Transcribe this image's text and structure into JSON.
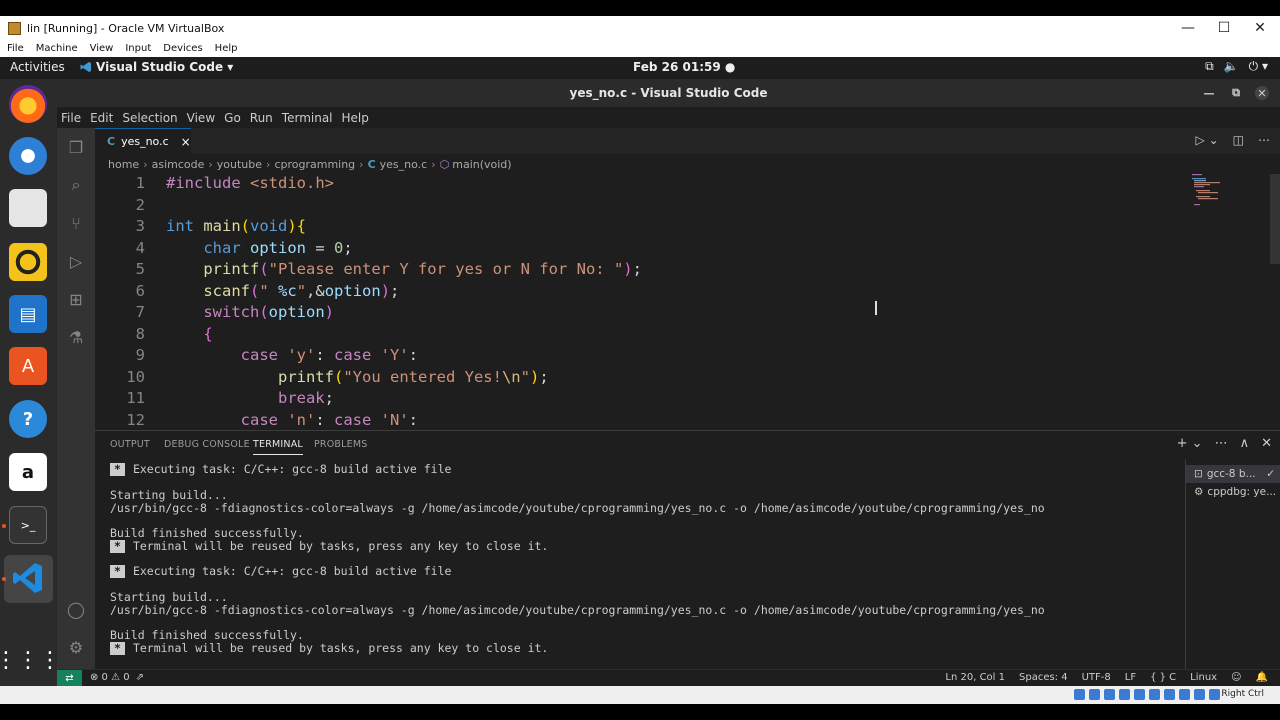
{
  "vbox": {
    "title": "lin [Running] - Oracle VM VirtualBox",
    "menu": [
      "File",
      "Machine",
      "View",
      "Input",
      "Devices",
      "Help"
    ],
    "host_key": "Right Ctrl"
  },
  "gnome": {
    "activities": "Activities",
    "app_name": "Visual Studio Code ▾",
    "clock": "Feb 26  01:59 ●"
  },
  "dock": {
    "items": [
      "firefox-icon",
      "thunderbird-icon",
      "files-icon",
      "rhythmbox-icon",
      "libreoffice-writer-icon",
      "ubuntu-software-icon",
      "help-icon",
      "amazon-icon",
      "terminal-icon",
      "vscode-icon"
    ]
  },
  "vscode": {
    "title": "yes_no.c - Visual Studio Code",
    "menu": [
      "File",
      "Edit",
      "Selection",
      "View",
      "Go",
      "Run",
      "Terminal",
      "Help"
    ],
    "tab": {
      "lang": "C",
      "label": "yes_no.c",
      "close": "×"
    },
    "breadcrumb": [
      "home",
      "asimcode",
      "youtube",
      "cprogramming",
      "yes_no.c",
      "main(void)"
    ],
    "breadcrumb_lang": "C",
    "line_numbers": [
      "1",
      "2",
      "3",
      "4",
      "5",
      "6",
      "7",
      "8",
      "9",
      "10",
      "11",
      "12"
    ],
    "panel_tabs": [
      "OUTPUT",
      "DEBUG CONSOLE",
      "TERMINAL",
      "PROBLEMS"
    ],
    "terminal_lines": [
      "Executing task: C/C++: gcc-8 build active file",
      "",
      "Starting build...",
      "/usr/bin/gcc-8 -fdiagnostics-color=always -g /home/asimcode/youtube/cprogramming/yes_no.c -o /home/asimcode/youtube/cprogramming/yes_no",
      "",
      "Build finished successfully.",
      "Terminal will be reused by tasks, press any key to close it.",
      "",
      "Executing task: C/C++: gcc-8 build active file",
      "",
      "Starting build...",
      "/usr/bin/gcc-8 -fdiagnostics-color=always -g /home/asimcode/youtube/cprogramming/yes_no.c -o /home/asimcode/youtube/cprogramming/yes_no",
      "",
      "Build finished successfully.",
      "Terminal will be reused by tasks, press any key to close it."
    ],
    "terminal_list": [
      "gcc-8 b...",
      "cppdbg: ye..."
    ],
    "status": {
      "problems": "⊗ 0 ⚠ 0",
      "position": "Ln 20, Col 1",
      "spaces": "Spaces: 4",
      "encoding": "UTF-8",
      "eol": "LF",
      "language": "{ } C",
      "platform": "Linux"
    }
  }
}
